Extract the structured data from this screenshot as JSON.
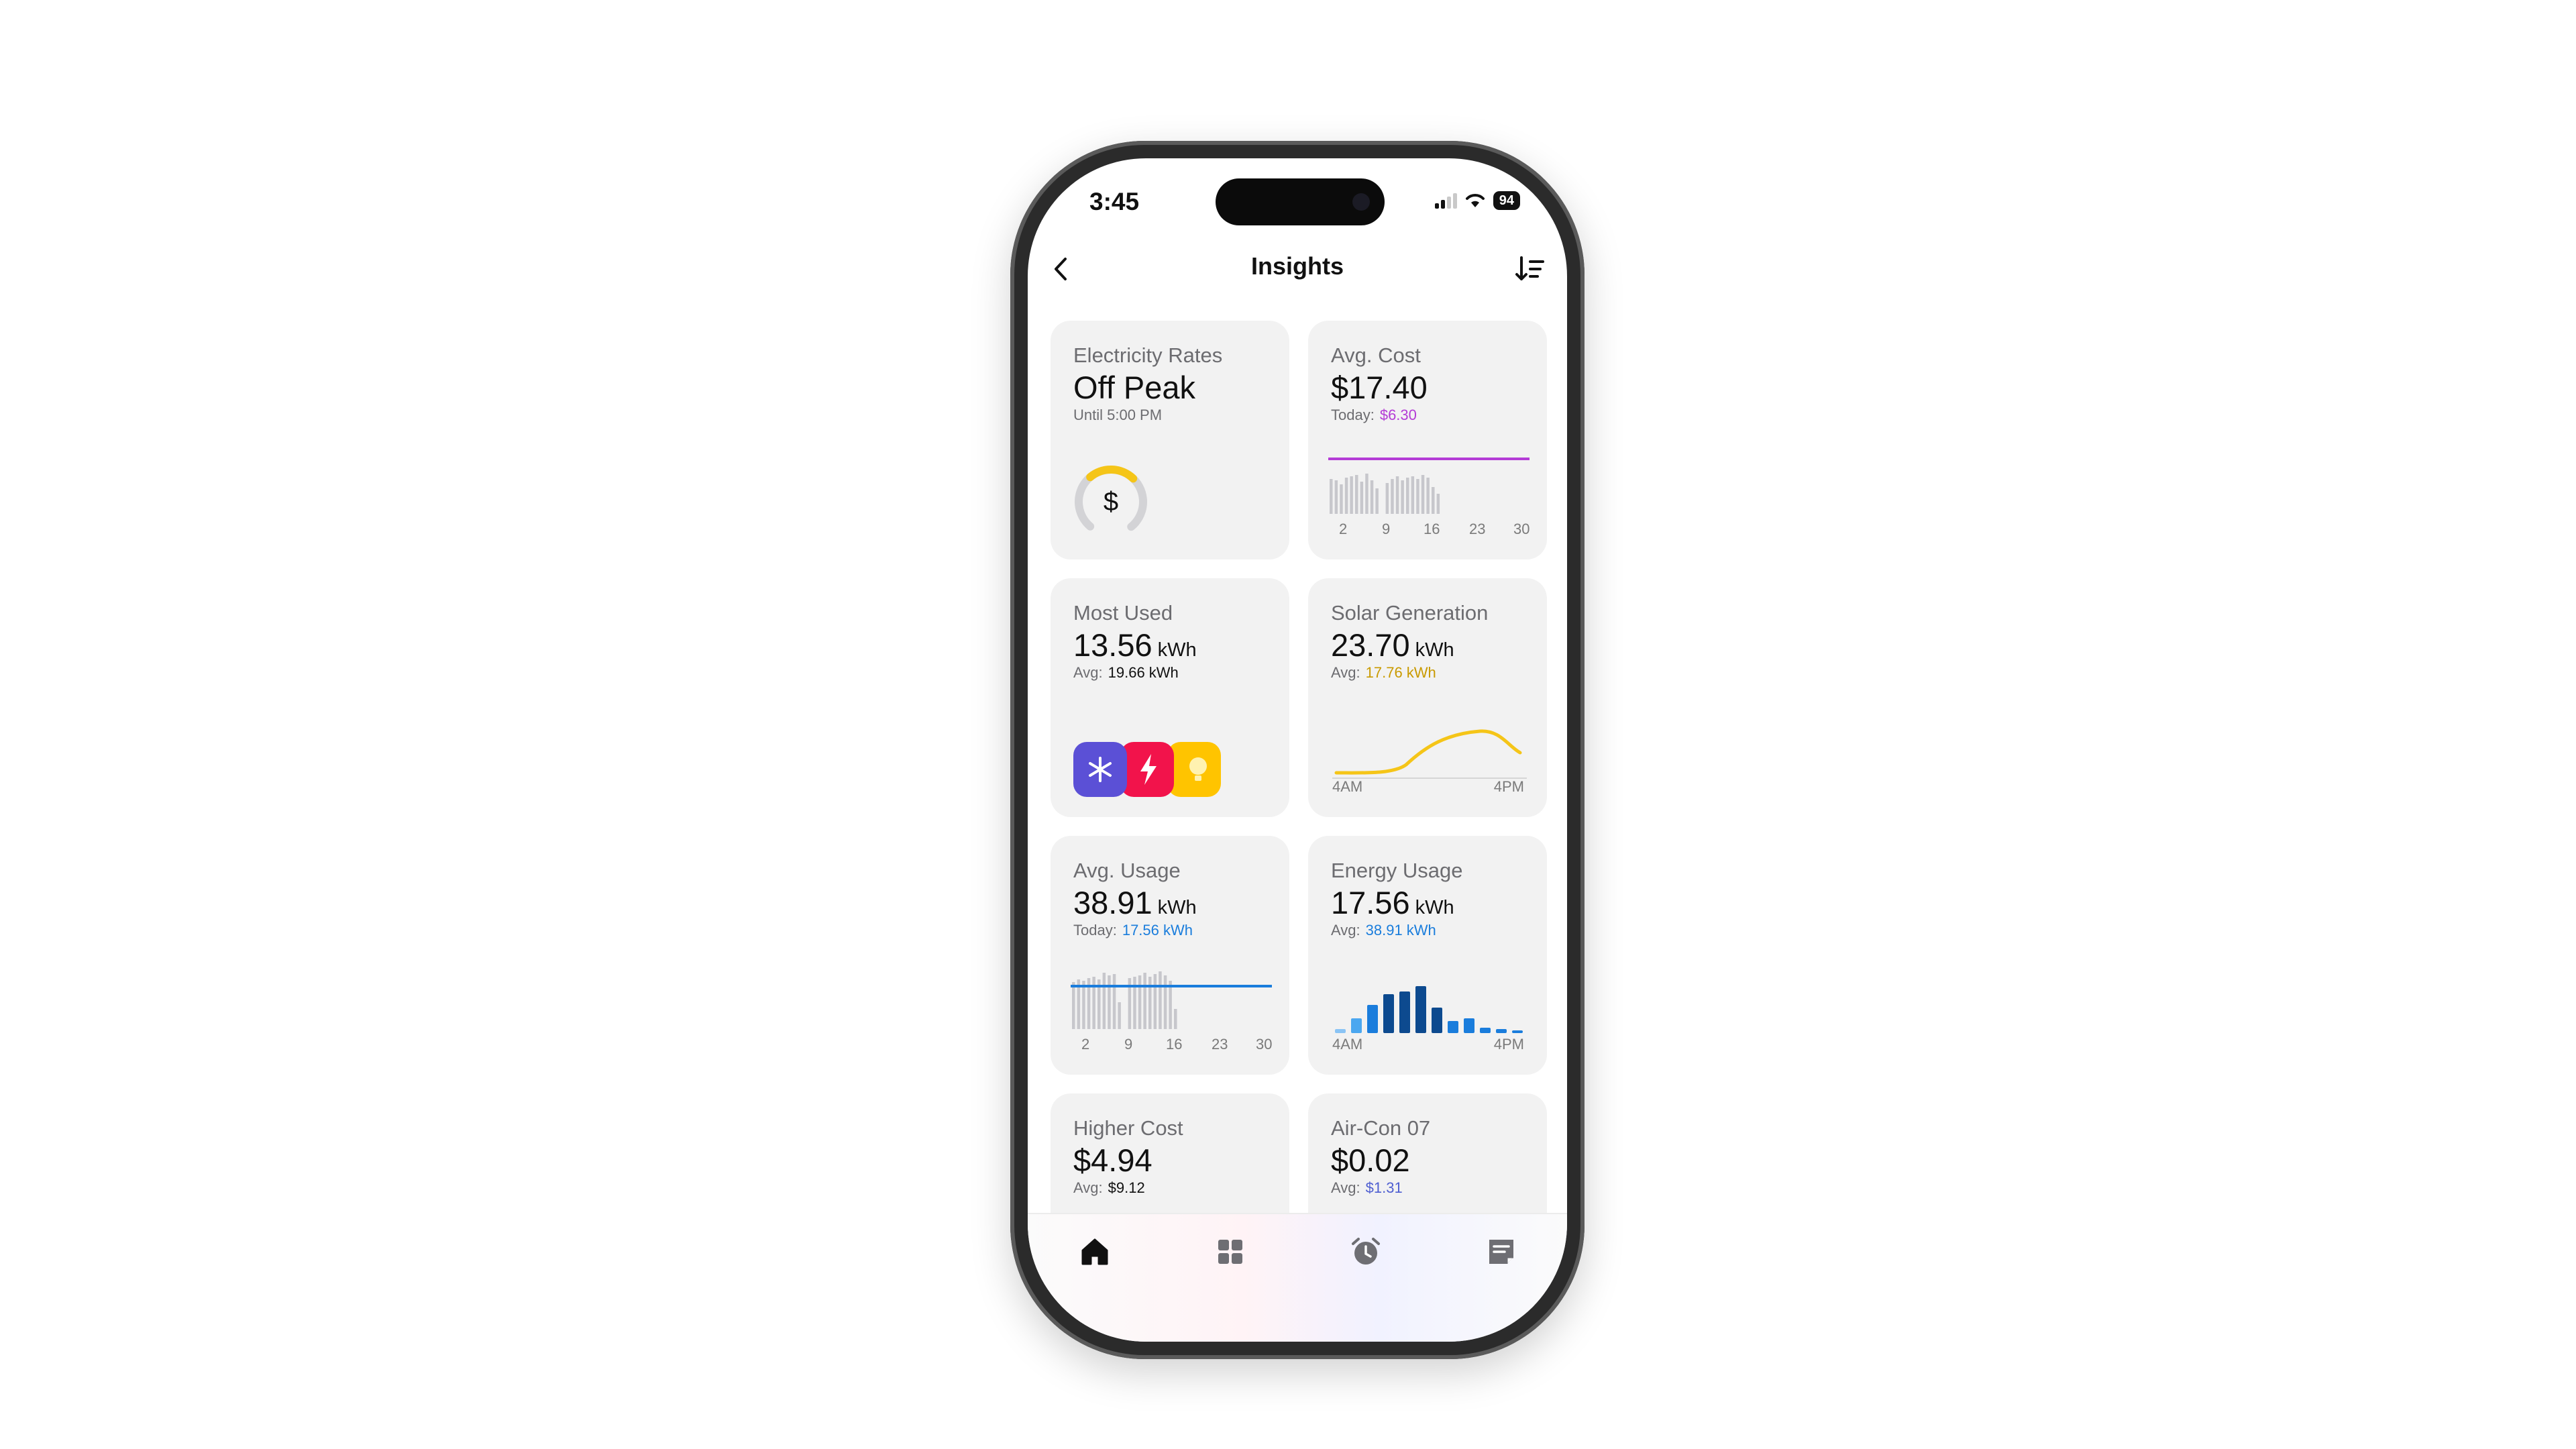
{
  "status_bar": {
    "time": "3:45",
    "battery": "94"
  },
  "nav": {
    "title": "Insights",
    "back_icon": "chevron-left-icon",
    "sort_icon": "sort-descending-icon"
  },
  "cards": {
    "electricity_rates": {
      "label": "Electricity Rates",
      "value": "Off Peak",
      "sub": "Until 5:00 PM",
      "icon": "dollar-gauge-icon"
    },
    "avg_cost": {
      "label": "Avg. Cost",
      "value": "$17.40",
      "sub_label": "Today:",
      "sub_value": "$6.30",
      "accent": "#b43cd6",
      "chart_ticks": [
        "2",
        "9",
        "16",
        "23",
        "30"
      ]
    },
    "most_used": {
      "label": "Most Used",
      "value": "13.56",
      "unit": "kWh",
      "sub_label": "Avg:",
      "sub_value": "19.66 kWh",
      "icons": [
        "snowflake-icon",
        "bolt-icon",
        "lightbulb-icon"
      ]
    },
    "solar_generation": {
      "label": "Solar Generation",
      "value": "23.70",
      "unit": "kWh",
      "sub_label": "Avg:",
      "sub_value": "17.76 kWh",
      "accent": "#c99a00",
      "line_color": "#f5c518",
      "x_start": "4AM",
      "x_end": "4PM"
    },
    "avg_usage": {
      "label": "Avg. Usage",
      "value": "38.91",
      "unit": "kWh",
      "sub_label": "Today:",
      "sub_value": "17.56 kWh",
      "accent": "#1a7ddc",
      "chart_ticks": [
        "2",
        "9",
        "16",
        "23",
        "30"
      ]
    },
    "energy_usage": {
      "label": "Energy Usage",
      "value": "17.56",
      "unit": "kWh",
      "sub_label": "Avg:",
      "sub_value": "38.91 kWh",
      "accent": "#1a7ddc",
      "x_start": "4AM",
      "x_end": "4PM"
    },
    "higher_cost": {
      "label": "Higher Cost",
      "value": "$4.94",
      "sub_label": "Avg:",
      "sub_value": "$9.12"
    },
    "air_con": {
      "label": "Air-Con 07",
      "value": "$0.02",
      "sub_label": "Avg:",
      "sub_value": "$1.31",
      "accent": "#4f5fd1"
    }
  },
  "tab_bar": {
    "items": [
      "home-icon",
      "grid-icon",
      "alarm-clock-icon",
      "notes-icon"
    ],
    "active": "home-icon"
  }
}
